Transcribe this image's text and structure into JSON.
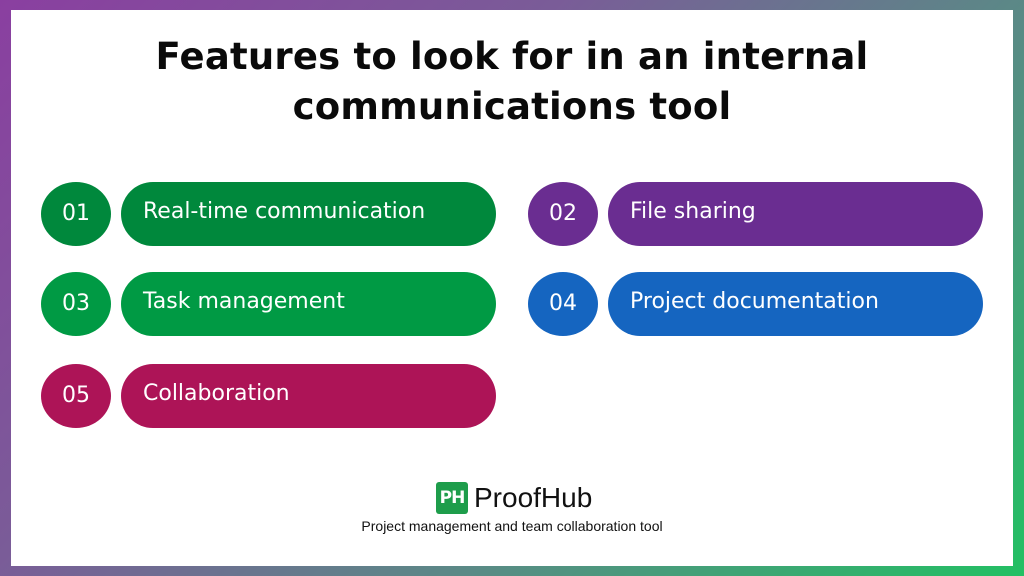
{
  "title": {
    "line1": "Features to look for in an internal",
    "line2": "communications tool"
  },
  "features": [
    {
      "number": "01",
      "label": "Real-time communication",
      "color": "#00883c"
    },
    {
      "number": "02",
      "label": "File sharing",
      "color": "#6a2d91"
    },
    {
      "number": "03",
      "label": "Task management",
      "color": "#009a44"
    },
    {
      "number": "04",
      "label": "Project documentation",
      "color": "#1565c0"
    },
    {
      "number": "05",
      "label": "Collaboration",
      "color": "#ad1457"
    }
  ],
  "brand": {
    "logo_mark": "PH",
    "name": "ProofHub",
    "tagline": "Project management and team collaboration tool",
    "color": "#1e9d4b"
  }
}
